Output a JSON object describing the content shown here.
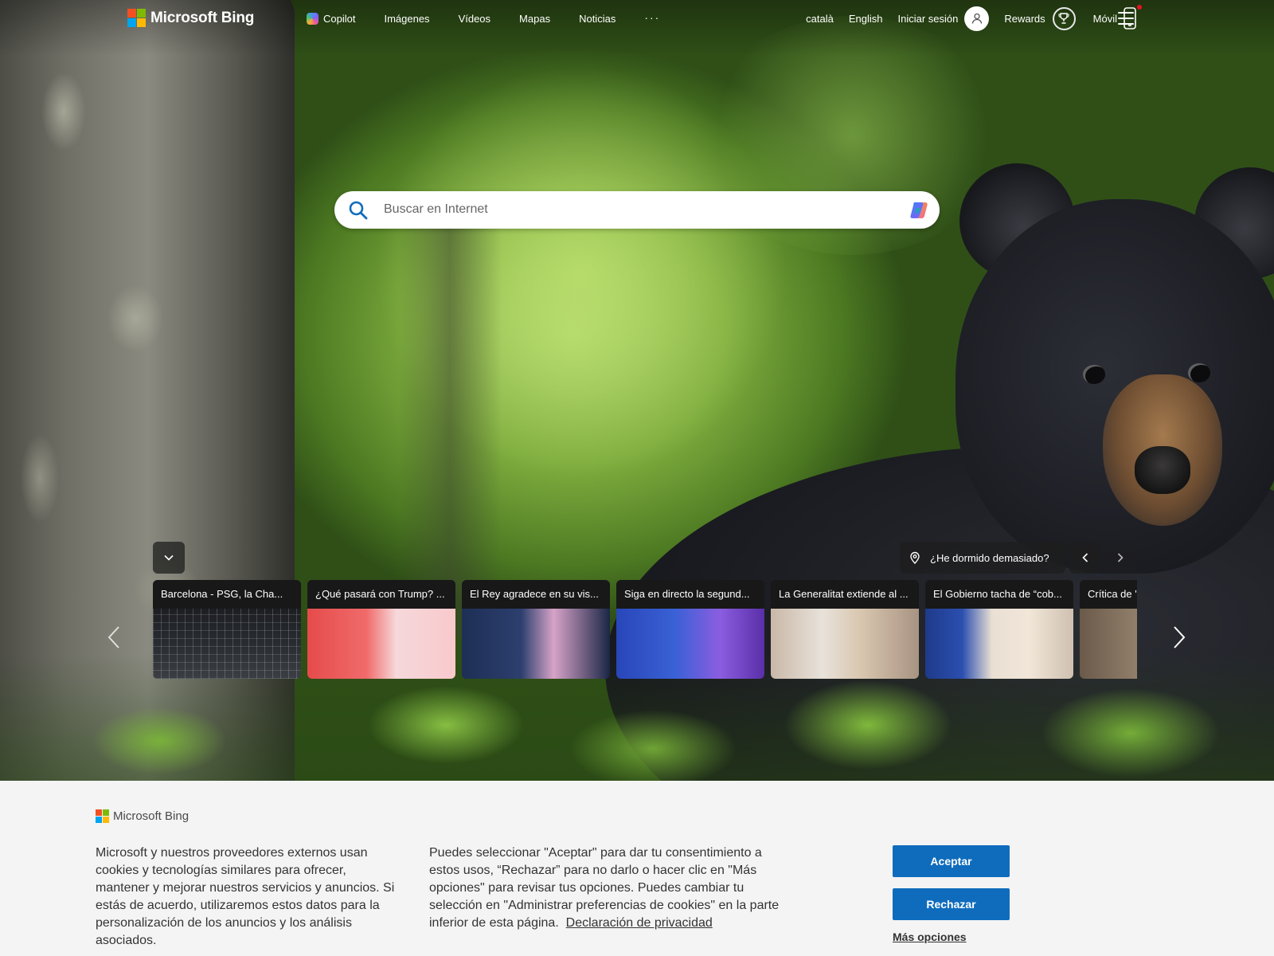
{
  "header": {
    "brand": "Microsoft Bing",
    "nav": [
      {
        "label": "Copilot",
        "icon": "copilot-icon"
      },
      {
        "label": "Imágenes"
      },
      {
        "label": "Vídeos"
      },
      {
        "label": "Mapas"
      },
      {
        "label": "Noticias"
      },
      {
        "label": "···"
      }
    ],
    "lang_catala": "català",
    "lang_english": "English",
    "sign_in": "Iniciar sesión",
    "rewards": "Rewards",
    "mobile": "Móvil"
  },
  "search": {
    "placeholder": "Buscar en Internet"
  },
  "hero": {
    "location_question": "¿He dormido demasiado?"
  },
  "news": [
    {
      "title": "Barcelona - PSG, la Cha...",
      "image": "soccer-goal-net"
    },
    {
      "title": "¿Qué pasará con Trump? ...",
      "image": "trump-portrait"
    },
    {
      "title": "El Rey agradece en su vis...",
      "image": "king-and-queen"
    },
    {
      "title": "Siga en directo la segund...",
      "image": "conference-speaker"
    },
    {
      "title": "La Generalitat extiende al ...",
      "image": "woman-at-podium"
    },
    {
      "title": "El Gobierno tacha de “cob...",
      "image": "spokeswoman-flags"
    },
    {
      "title": "Crítica de '",
      "image": "street-scene"
    }
  ],
  "cookie": {
    "brand": "Microsoft Bing",
    "text_left": "Microsoft y nuestros proveedores externos usan cookies y tecnologías similares para ofrecer, mantener y mejorar nuestros servicios y anuncios. Si estás de acuerdo, utilizaremos estos datos para la personalización de los anuncios y los análisis asociados.",
    "text_right": "Puedes seleccionar \"Aceptar\" para dar tu consentimiento a estos usos, “Rechazar” para no darlo o hacer clic en \"Más opciones\" para revisar tus opciones. Puedes cambiar tu selección en \"Administrar preferencias de cookies\" en la parte inferior de esta página.",
    "privacy_link": "Declaración de privacidad",
    "accept": "Aceptar",
    "reject": "Rechazar",
    "more_options": "Más opciones"
  },
  "colors": {
    "accent_blue": "#0f6cbd",
    "banner_bg": "#f4f4f4",
    "notification_dot": "#e81123"
  }
}
